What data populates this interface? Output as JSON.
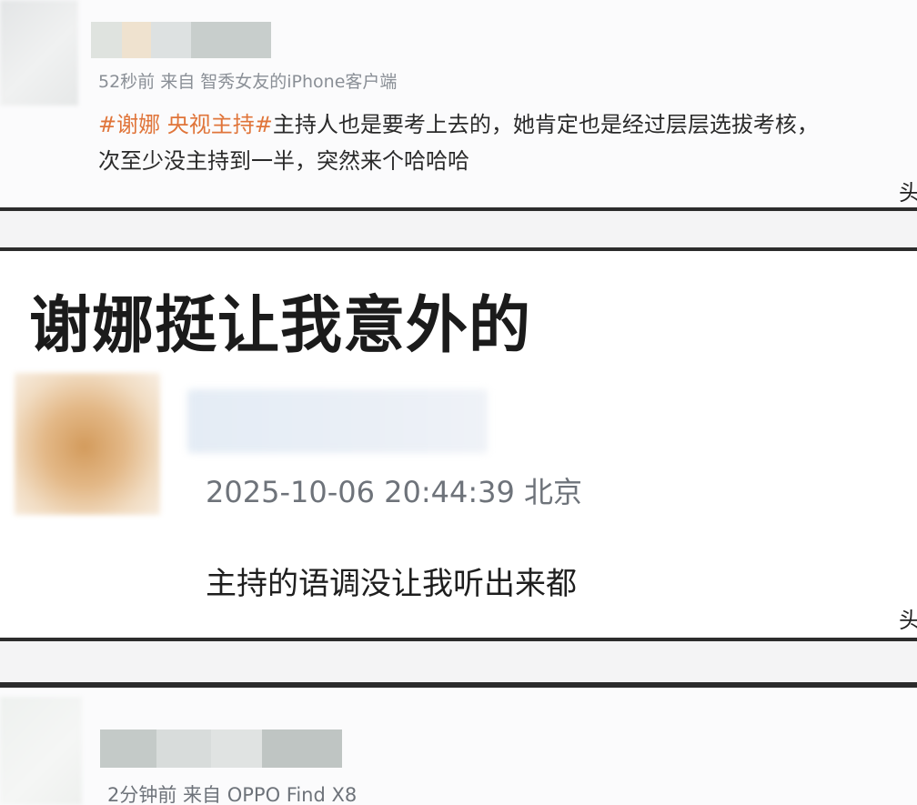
{
  "post1": {
    "meta": "52秒前  来自 智秀女友的iPhone客户端",
    "tag_label": "#谢娜 央视主持#",
    "text_line1": "主持人也是要考上去的，她肯定也是经过层层选拔考核，",
    "text_line2": "次至少没主持到一半，突然来个哈哈哈",
    "cutoff_glyph": "头"
  },
  "post2": {
    "headline": "谢娜挺让我意外的",
    "meta": "2025-10-06 20:44:39 北京",
    "text": "主持的语调没让我听出来都",
    "cutoff_glyph": "头"
  },
  "post3": {
    "meta": "2分钟前  来自 OPPO Find X8"
  },
  "colors": {
    "tag": "#e0753a",
    "separator": "#2c2c2c",
    "meta_text": "#8a8f96"
  }
}
